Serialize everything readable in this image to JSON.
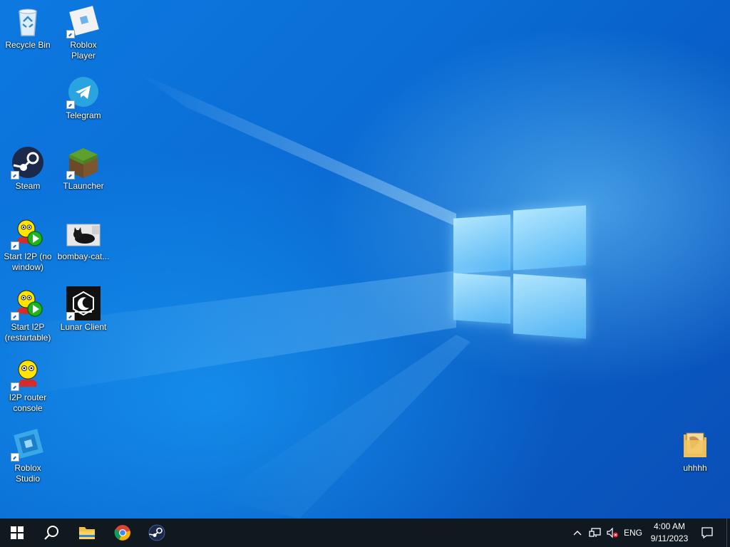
{
  "desktop": {
    "icons": [
      {
        "name": "recycle-bin",
        "label": "Recycle Bin",
        "icon": "recycle-bin-icon"
      },
      {
        "name": "roblox-player",
        "label": "Roblox Player",
        "icon": "roblox-player-icon"
      },
      {
        "name": "telegram",
        "label": "Telegram",
        "icon": "telegram-icon"
      },
      {
        "name": "steam",
        "label": "Steam",
        "icon": "steam-icon"
      },
      {
        "name": "tlauncher",
        "label": "TLauncher",
        "icon": "tlauncher-icon"
      },
      {
        "name": "start-i2p-no-window",
        "label": "Start I2P (no window)",
        "icon": "i2p-start-icon"
      },
      {
        "name": "bombay-cat",
        "label": "bombay-cat...",
        "icon": "cat-image-icon"
      },
      {
        "name": "start-i2p-restartable",
        "label": "Start I2P (restartable)",
        "icon": "i2p-start-icon"
      },
      {
        "name": "lunar-client",
        "label": "Lunar Client",
        "icon": "lunar-client-icon"
      },
      {
        "name": "i2p-router-console",
        "label": "I2P router console",
        "icon": "i2p-icon"
      },
      {
        "name": "roblox-studio",
        "label": "Roblox Studio",
        "icon": "roblox-studio-icon"
      },
      {
        "name": "uhhhh",
        "label": "uhhhh",
        "icon": "folder-icon"
      }
    ]
  },
  "taskbar": {
    "start": "windows-start-icon",
    "search": "search-icon",
    "pinned": [
      "file-explorer-icon",
      "chrome-icon",
      "steam-icon"
    ],
    "tray": {
      "language": "ENG",
      "time": "4:00 AM",
      "date": "9/11/2023"
    }
  },
  "colors": {
    "taskbar": "#101820",
    "wallpaper": "#0a6fd6"
  }
}
